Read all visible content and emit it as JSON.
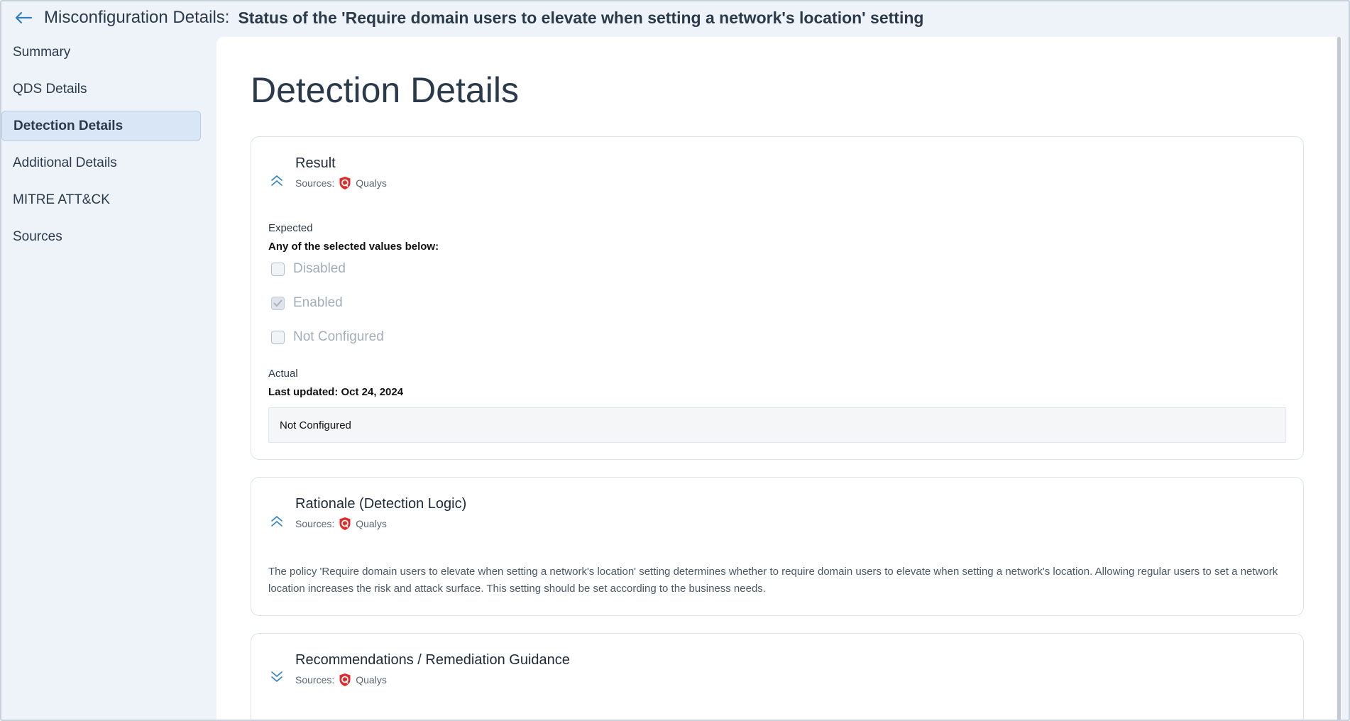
{
  "header": {
    "label": "Misconfiguration Details:",
    "title": "Status of the 'Require domain users to elevate when setting a network's location' setting"
  },
  "sidebar": {
    "items": [
      {
        "label": "Summary"
      },
      {
        "label": "QDS Details"
      },
      {
        "label": "Detection Details",
        "active": true
      },
      {
        "label": "Additional Details"
      },
      {
        "label": "MITRE ATT&CK"
      },
      {
        "label": "Sources"
      }
    ]
  },
  "main": {
    "page_title": "Detection Details",
    "sources_label": "Sources:",
    "source_name": "Qualys",
    "result_card": {
      "title": "Result",
      "expected_label": "Expected",
      "expected_desc": "Any of the selected values below:",
      "options": [
        {
          "label": "Disabled",
          "checked": false
        },
        {
          "label": "Enabled",
          "checked": true
        },
        {
          "label": "Not Configured",
          "checked": false
        }
      ],
      "actual_label": "Actual",
      "last_updated": "Last updated: Oct 24, 2024",
      "actual_value": "Not Configured"
    },
    "rationale_card": {
      "title": "Rationale (Detection Logic)",
      "description": "The policy 'Require domain users to elevate when setting a network's location' setting determines whether to require domain users to elevate when setting a network's location. Allowing regular users to set a network location increases the risk and attack surface. This setting should be set according to the business needs."
    },
    "recommendations_card": {
      "title": "Recommendations / Remediation Guidance"
    }
  },
  "colors": {
    "accent": "#2f7fc1",
    "qualys_red": "#e02b2b",
    "sidebar_active_bg": "#d9e6f5"
  }
}
